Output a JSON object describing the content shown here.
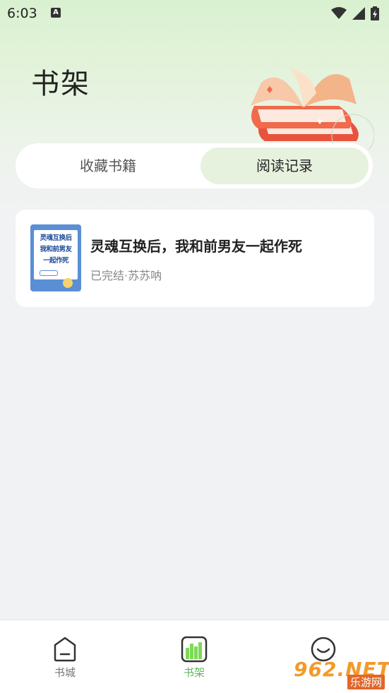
{
  "status": {
    "time": "6:03",
    "notif_letter": "A"
  },
  "header": {
    "title": "书架"
  },
  "tabs": [
    {
      "label": "收藏书籍",
      "selected": false
    },
    {
      "label": "阅读记录",
      "selected": true
    }
  ],
  "books": [
    {
      "title": "灵魂互换后，我和前男友一起作死",
      "meta": "已完结·苏苏呐",
      "cover_lines": [
        "灵魂互换后",
        "我和前男友",
        "一起作死"
      ]
    }
  ],
  "bottom_nav": [
    {
      "label": "书城",
      "icon": "home-icon",
      "active": false
    },
    {
      "label": "书架",
      "icon": "bookshelf-icon",
      "active": true
    },
    {
      "label": "",
      "icon": "profile-icon",
      "active": false
    }
  ],
  "watermark": {
    "text": "962.NET",
    "sub": "乐游网"
  },
  "colors": {
    "accent": "#5cb85c",
    "tab_selected_bg": "#e6f1de",
    "page_bg": "#f1f2f4"
  }
}
